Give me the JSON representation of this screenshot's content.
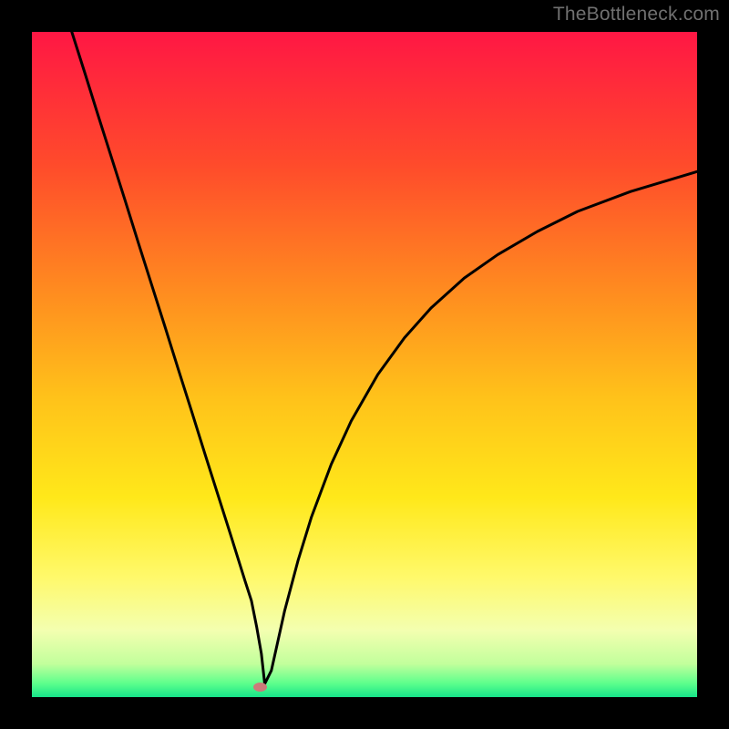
{
  "watermark": "TheBottleneck.com",
  "chart_data": {
    "type": "line",
    "title": "",
    "xlabel": "",
    "ylabel": "",
    "xlim": [
      0,
      100
    ],
    "ylim": [
      0,
      100
    ],
    "gradient_stops": [
      {
        "offset": 0,
        "color": "#ff1744"
      },
      {
        "offset": 20,
        "color": "#ff4b2b"
      },
      {
        "offset": 40,
        "color": "#ff8f1f"
      },
      {
        "offset": 55,
        "color": "#ffc21a"
      },
      {
        "offset": 70,
        "color": "#ffe81a"
      },
      {
        "offset": 82,
        "color": "#fff96b"
      },
      {
        "offset": 90,
        "color": "#f3ffb0"
      },
      {
        "offset": 95,
        "color": "#c2ff9c"
      },
      {
        "offset": 98,
        "color": "#5bff8c"
      },
      {
        "offset": 100,
        "color": "#17e389"
      }
    ],
    "series": [
      {
        "name": "bottleneck-curve",
        "x": [
          6,
          8,
          10,
          12,
          14,
          16,
          18,
          20,
          22,
          24,
          26,
          28,
          30,
          31,
          32,
          33,
          33.8,
          34.5,
          35,
          36,
          37,
          38,
          40,
          42,
          45,
          48,
          52,
          56,
          60,
          65,
          70,
          76,
          82,
          90,
          100
        ],
        "y": [
          100,
          93.7,
          87.3,
          81.0,
          74.7,
          68.3,
          62.0,
          55.7,
          49.3,
          43.0,
          36.6,
          30.3,
          24.0,
          20.8,
          17.6,
          14.5,
          10.5,
          6.5,
          2.0,
          4.0,
          8.5,
          13.0,
          20.5,
          27.0,
          35.0,
          41.5,
          48.5,
          54.0,
          58.5,
          63.0,
          66.5,
          70.0,
          73.0,
          76.0,
          79.0
        ]
      }
    ],
    "marker": {
      "x": 34.3,
      "y": 1.5,
      "color": "#cc7a7a"
    }
  }
}
